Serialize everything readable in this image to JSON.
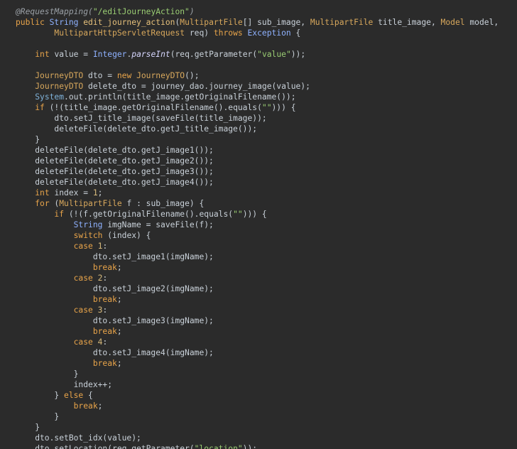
{
  "editor": {
    "lines": [
      [
        {
          "t": "@RequestMapping(",
          "c": "ann"
        },
        {
          "t": "\"/editJourneyAction\"",
          "c": "str"
        },
        {
          "t": ")",
          "c": "ann"
        }
      ],
      [
        {
          "t": "public ",
          "c": "kw"
        },
        {
          "t": "String ",
          "c": "type"
        },
        {
          "t": "edit_journey_action",
          "c": "fn"
        },
        {
          "t": "(",
          "c": "id"
        },
        {
          "t": "MultipartFile",
          "c": "cls"
        },
        {
          "t": "[] sub_image, ",
          "c": "id"
        },
        {
          "t": "MultipartFile ",
          "c": "cls"
        },
        {
          "t": "title_image, ",
          "c": "id"
        },
        {
          "t": "Model ",
          "c": "cls"
        },
        {
          "t": "model,",
          "c": "id"
        }
      ],
      [
        {
          "t": "        MultipartHttpServletRequest ",
          "c": "cls"
        },
        {
          "t": "req) ",
          "c": "id"
        },
        {
          "t": "throws ",
          "c": "kw"
        },
        {
          "t": "Exception ",
          "c": "type"
        },
        {
          "t": "{",
          "c": "id"
        }
      ],
      [],
      [
        {
          "t": "    ",
          "c": "id"
        },
        {
          "t": "int ",
          "c": "kw"
        },
        {
          "t": "value = ",
          "c": "id"
        },
        {
          "t": "Integer",
          "c": "type"
        },
        {
          "t": ".",
          "c": "id"
        },
        {
          "t": "parseInt",
          "c": "it"
        },
        {
          "t": "(req.getParameter(",
          "c": "id"
        },
        {
          "t": "\"value\"",
          "c": "str"
        },
        {
          "t": "));",
          "c": "id"
        }
      ],
      [],
      [
        {
          "t": "    ",
          "c": "id"
        },
        {
          "t": "JourneyDTO ",
          "c": "cls"
        },
        {
          "t": "dto = ",
          "c": "id"
        },
        {
          "t": "new ",
          "c": "kw"
        },
        {
          "t": "JourneyDTO",
          "c": "cls"
        },
        {
          "t": "();",
          "c": "id"
        }
      ],
      [
        {
          "t": "    ",
          "c": "id"
        },
        {
          "t": "JourneyDTO ",
          "c": "cls"
        },
        {
          "t": "delete_dto = journey_dao.journey_image(value);",
          "c": "id"
        }
      ],
      [
        {
          "t": "    ",
          "c": "id"
        },
        {
          "t": "System",
          "c": "sys"
        },
        {
          "t": ".out.println(title_image.getOriginalFilename());",
          "c": "id"
        }
      ],
      [
        {
          "t": "    ",
          "c": "id"
        },
        {
          "t": "if ",
          "c": "kw"
        },
        {
          "t": "(!(title_image.getOriginalFilename().equals(",
          "c": "id"
        },
        {
          "t": "\"\"",
          "c": "str"
        },
        {
          "t": "))) {",
          "c": "id"
        }
      ],
      [
        {
          "t": "        dto.setJ_title_image(saveFile(title_image));",
          "c": "id"
        }
      ],
      [
        {
          "t": "        deleteFile(delete_dto.getJ_title_image());",
          "c": "id"
        }
      ],
      [
        {
          "t": "    }",
          "c": "id"
        }
      ],
      [
        {
          "t": "    deleteFile(delete_dto.getJ_image1());",
          "c": "id"
        }
      ],
      [
        {
          "t": "    deleteFile(delete_dto.getJ_image2());",
          "c": "id"
        }
      ],
      [
        {
          "t": "    deleteFile(delete_dto.getJ_image3());",
          "c": "id"
        }
      ],
      [
        {
          "t": "    deleteFile(delete_dto.getJ_image4());",
          "c": "id"
        }
      ],
      [
        {
          "t": "    ",
          "c": "id"
        },
        {
          "t": "int ",
          "c": "kw"
        },
        {
          "t": "index = ",
          "c": "id"
        },
        {
          "t": "1",
          "c": "num"
        },
        {
          "t": ";",
          "c": "id"
        }
      ],
      [
        {
          "t": "    ",
          "c": "id"
        },
        {
          "t": "for ",
          "c": "kw"
        },
        {
          "t": "(",
          "c": "id"
        },
        {
          "t": "MultipartFile ",
          "c": "cls"
        },
        {
          "t": "f : sub_image) {",
          "c": "id"
        }
      ],
      [
        {
          "t": "        ",
          "c": "id"
        },
        {
          "t": "if ",
          "c": "kw"
        },
        {
          "t": "(!(f.getOriginalFilename().equals(",
          "c": "id"
        },
        {
          "t": "\"\"",
          "c": "str"
        },
        {
          "t": "))) {",
          "c": "id"
        }
      ],
      [
        {
          "t": "            ",
          "c": "id"
        },
        {
          "t": "String ",
          "c": "type"
        },
        {
          "t": "imgName = saveFile(f);",
          "c": "id"
        }
      ],
      [
        {
          "t": "            ",
          "c": "id"
        },
        {
          "t": "switch ",
          "c": "kw"
        },
        {
          "t": "(index) {",
          "c": "id"
        }
      ],
      [
        {
          "t": "            ",
          "c": "id"
        },
        {
          "t": "case ",
          "c": "kw"
        },
        {
          "t": "1",
          "c": "num"
        },
        {
          "t": ":",
          "c": "id"
        }
      ],
      [
        {
          "t": "                dto.setJ_image1(imgName);",
          "c": "id"
        }
      ],
      [
        {
          "t": "                ",
          "c": "id"
        },
        {
          "t": "break",
          "c": "kw"
        },
        {
          "t": ";",
          "c": "id"
        }
      ],
      [
        {
          "t": "            ",
          "c": "id"
        },
        {
          "t": "case ",
          "c": "kw"
        },
        {
          "t": "2",
          "c": "num"
        },
        {
          "t": ":",
          "c": "id"
        }
      ],
      [
        {
          "t": "                dto.setJ_image2(imgName);",
          "c": "id"
        }
      ],
      [
        {
          "t": "                ",
          "c": "id"
        },
        {
          "t": "break",
          "c": "kw"
        },
        {
          "t": ";",
          "c": "id"
        }
      ],
      [
        {
          "t": "            ",
          "c": "id"
        },
        {
          "t": "case ",
          "c": "kw"
        },
        {
          "t": "3",
          "c": "num"
        },
        {
          "t": ":",
          "c": "id"
        }
      ],
      [
        {
          "t": "                dto.setJ_image3(imgName);",
          "c": "id"
        }
      ],
      [
        {
          "t": "                ",
          "c": "id"
        },
        {
          "t": "break",
          "c": "kw"
        },
        {
          "t": ";",
          "c": "id"
        }
      ],
      [
        {
          "t": "            ",
          "c": "id"
        },
        {
          "t": "case ",
          "c": "kw"
        },
        {
          "t": "4",
          "c": "num"
        },
        {
          "t": ":",
          "c": "id"
        }
      ],
      [
        {
          "t": "                dto.setJ_image4(imgName);",
          "c": "id"
        }
      ],
      [
        {
          "t": "                ",
          "c": "id"
        },
        {
          "t": "break",
          "c": "kw"
        },
        {
          "t": ";",
          "c": "id"
        }
      ],
      [
        {
          "t": "            }",
          "c": "id"
        }
      ],
      [
        {
          "t": "            index++;",
          "c": "id"
        }
      ],
      [
        {
          "t": "        } ",
          "c": "id"
        },
        {
          "t": "else ",
          "c": "kw"
        },
        {
          "t": "{",
          "c": "id"
        }
      ],
      [
        {
          "t": "            ",
          "c": "id"
        },
        {
          "t": "break",
          "c": "kw"
        },
        {
          "t": ";",
          "c": "id"
        }
      ],
      [
        {
          "t": "        }",
          "c": "id"
        }
      ],
      [
        {
          "t": "    }",
          "c": "id"
        }
      ],
      [
        {
          "t": "    dto.setBot_idx(value);",
          "c": "id"
        }
      ],
      [
        {
          "t": "    dto.setLocation(req.getParameter(",
          "c": "id"
        },
        {
          "t": "\"location\"",
          "c": "str"
        },
        {
          "t": "));",
          "c": "id"
        }
      ]
    ]
  }
}
